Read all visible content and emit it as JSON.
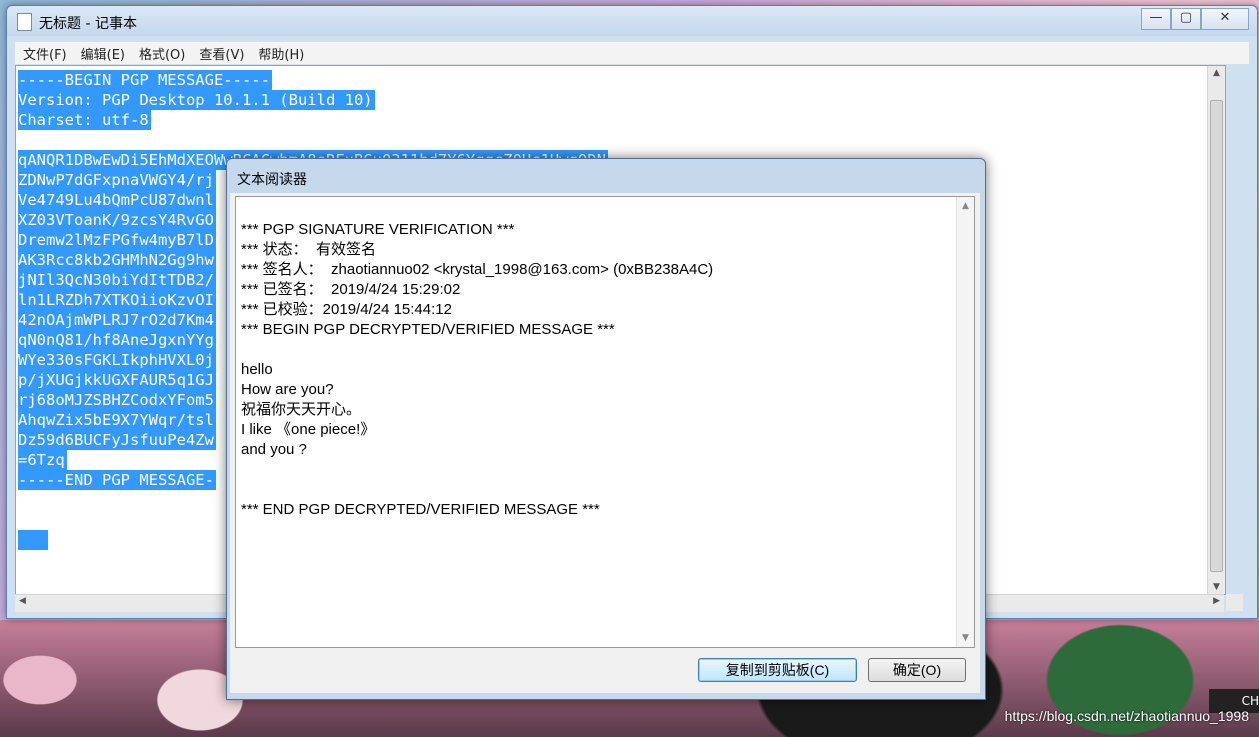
{
  "notepad": {
    "title": "无标题 - 记事本",
    "caption": {
      "minimize": "—",
      "maximize": "▢",
      "close": "✕"
    },
    "menu": [
      "文件(F)",
      "编辑(E)",
      "格式(O)",
      "查看(V)",
      "帮助(H)"
    ],
    "lines": [
      "-----BEGIN PGP MESSAGE-----",
      "Version: PGP Desktop 10.1.1 (Build 10)",
      "Charset: utf-8",
      "",
      "qANQR1DBwEwDi5EhMdXEOWwBCACwbmA8eRFxBGu0311bd7Y6YqqcZ0Hc1HwqQDN",
      "ZDNwP7dGFxpnaVWGY4/rj",
      "Ve4749Lu4bQmPcU87dwnl",
      "XZ03VToanK/9zcsY4RvGO",
      "Dremw2lMzFPGfw4myB7lD",
      "AK3Rcc8kb2GHMhN2Gg9hw",
      "jNIl3QcN30biYdItTDB2/",
      "ln1LRZDh7XTKOiioKzvOI",
      "42nOAjmWPLRJ7rO2d7Km4",
      "qN0nQ81/hf8AneJgxnYYg",
      "WYe330sFGKLIkphHVXL0j",
      "p/jXUGjkkUGXFAUR5q1GJ",
      "rj68oMJZSBHZCodxYFom5",
      "AhqwZix5bE9X7YWqr/tsl",
      "Dz59d6BUCFyJsfuuPe4Zw",
      "=6Tzq",
      "-----END PGP MESSAGE-",
      "",
      "",
      " "
    ]
  },
  "dialog": {
    "title": "文本阅读器",
    "lines": [
      "*** PGP SIGNATURE VERIFICATION ***",
      "*** 状态：  有效签名",
      "*** 签名人：  zhaotiannuo02 <krystal_1998@163.com> (0xBB238A4C)",
      "*** 已签名：  2019/4/24 15:29:02",
      "*** 已校验：2019/4/24 15:44:12",
      "*** BEGIN PGP DECRYPTED/VERIFIED MESSAGE ***",
      "",
      "hello",
      "How are you?",
      "祝福你天天开心。",
      "I like 《one piece!》",
      "and you ?",
      "",
      "",
      "*** END PGP DECRYPTED/VERIFIED MESSAGE ***"
    ],
    "copy_button": "复制到剪贴板(C)",
    "ok_button": "确定(O)"
  },
  "tray": {
    "ime": "CH"
  },
  "watermark": "https://blog.csdn.net/zhaotiannuo_1998"
}
